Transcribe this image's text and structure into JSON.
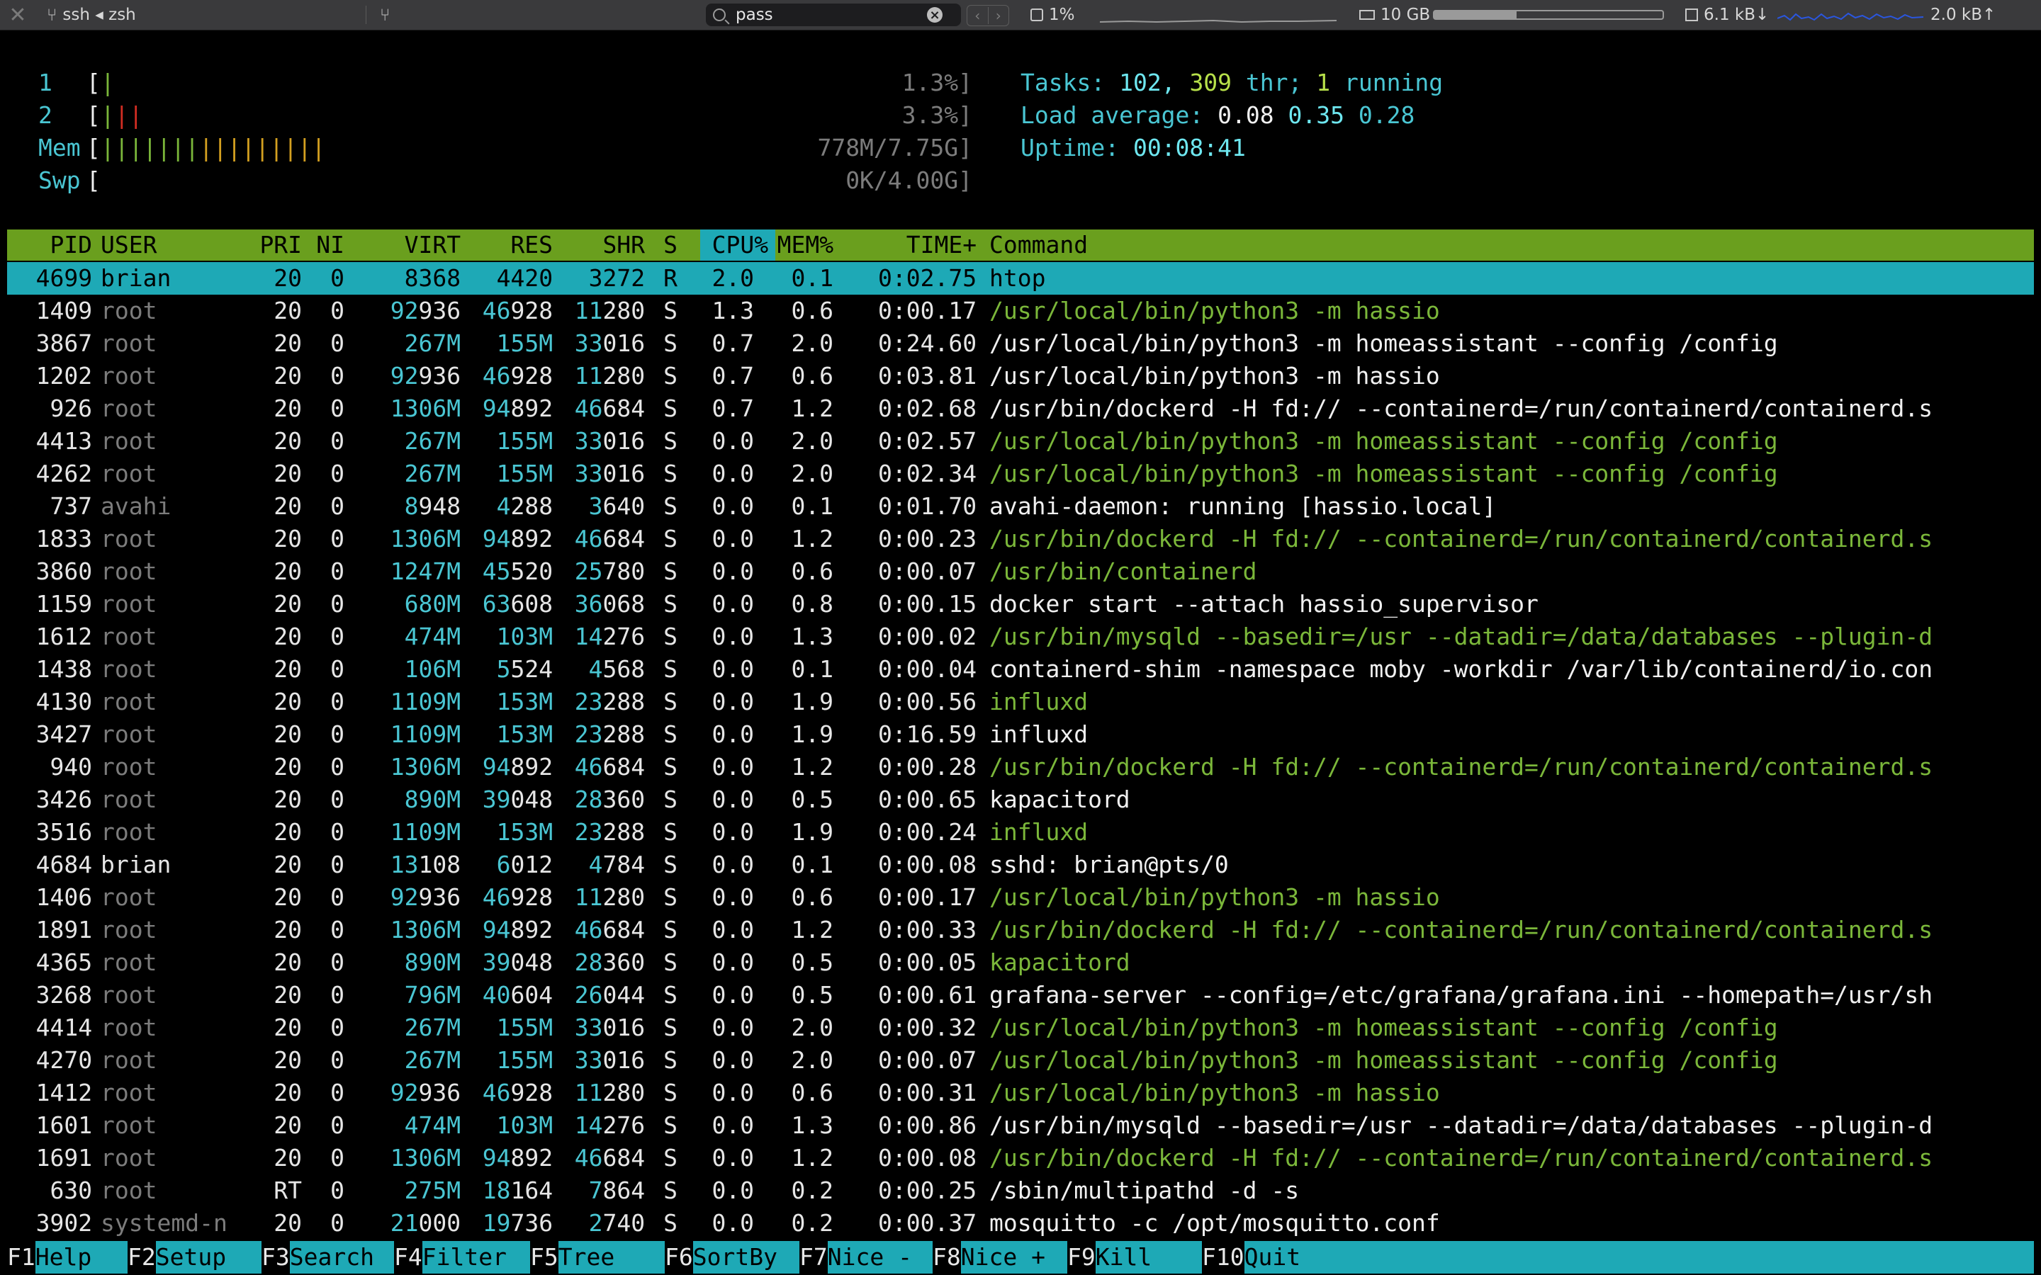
{
  "window": {
    "tab_title": "ssh ◂ zsh",
    "search_value": "pass",
    "cpu_label": "1%",
    "mem_label": "10 GB",
    "mem_fraction": 0.36,
    "net_down": "6.1 kB↓",
    "net_up": "2.0 kB↑",
    "accent": "#1ea9b6"
  },
  "meters": {
    "cpu1": {
      "label": "1",
      "value": "1.3%]",
      "bars": [
        {
          "ch": "|",
          "color": "green"
        }
      ]
    },
    "cpu2": {
      "label": "2",
      "value": "3.3%]",
      "bars": [
        {
          "ch": "|",
          "color": "green"
        },
        {
          "ch": "|",
          "color": "red"
        },
        {
          "ch": "|",
          "color": "red"
        }
      ]
    },
    "mem": {
      "label": "Mem",
      "value": "778M/7.75G]",
      "bars": [
        {
          "ch": "|",
          "color": "green"
        },
        {
          "ch": "|",
          "color": "green"
        },
        {
          "ch": "|",
          "color": "green"
        },
        {
          "ch": "|",
          "color": "green"
        },
        {
          "ch": "|",
          "color": "green"
        },
        {
          "ch": "|",
          "color": "green"
        },
        {
          "ch": "|",
          "color": "green"
        },
        {
          "ch": "|",
          "color": "yellow"
        },
        {
          "ch": "|",
          "color": "yellow"
        },
        {
          "ch": "|",
          "color": "yellow"
        },
        {
          "ch": "|",
          "color": "yellow"
        },
        {
          "ch": "|",
          "color": "yellow"
        },
        {
          "ch": "|",
          "color": "yellow"
        },
        {
          "ch": "|",
          "color": "yellow"
        },
        {
          "ch": "|",
          "color": "yellow"
        },
        {
          "ch": "|",
          "color": "yellow"
        }
      ]
    },
    "swp": {
      "label": "Swp",
      "value": "0K/4.00G]",
      "bars": []
    },
    "bracket": "["
  },
  "summary": {
    "tasks_label": "Tasks: ",
    "tasks": "102",
    "comma": ", ",
    "threads": "309",
    "thr_label": " thr; ",
    "running": "1",
    "running_label": " running",
    "load_label": "Load average: ",
    "load1": "0.08",
    "load5": "0.35",
    "load15": "0.28",
    "uptime_label": "Uptime: ",
    "uptime": "00:08:41"
  },
  "columns": [
    "PID",
    "USER",
    "PRI",
    "NI",
    "VIRT",
    "RES",
    "SHR",
    "S",
    "CPU%",
    "MEM%",
    "TIME+",
    "Command"
  ],
  "processes": [
    {
      "pid": "4699",
      "user": "brian",
      "pri": "20",
      "ni": "0",
      "virt": "8368",
      "res": "4420",
      "shr": "3272",
      "s": "R",
      "cpu": "2.0",
      "mem": "0.1",
      "time": "0:02.75",
      "cmd": "htop",
      "cmdc": "white",
      "sel": true
    },
    {
      "pid": "1409",
      "user": "root",
      "pri": "20",
      "ni": "0",
      "virt": "92936",
      "res": "46928",
      "shr": "11280",
      "s": "S",
      "cpu": "1.3",
      "mem": "0.6",
      "time": "0:00.17",
      "cmd": "/usr/local/bin/python3 -m hassio",
      "cmdc": "green"
    },
    {
      "pid": "3867",
      "user": "root",
      "pri": "20",
      "ni": "0",
      "virt": "267M",
      "res": "155M",
      "shr": "33016",
      "s": "S",
      "cpu": "0.7",
      "mem": "2.0",
      "time": "0:24.60",
      "cmd": "/usr/local/bin/python3 -m homeassistant --config /config",
      "cmdc": "white"
    },
    {
      "pid": "1202",
      "user": "root",
      "pri": "20",
      "ni": "0",
      "virt": "92936",
      "res": "46928",
      "shr": "11280",
      "s": "S",
      "cpu": "0.7",
      "mem": "0.6",
      "time": "0:03.81",
      "cmd": "/usr/local/bin/python3 -m hassio",
      "cmdc": "white"
    },
    {
      "pid": "926",
      "user": "root",
      "pri": "20",
      "ni": "0",
      "virt": "1306M",
      "res": "94892",
      "shr": "46684",
      "s": "S",
      "cpu": "0.7",
      "mem": "1.2",
      "time": "0:02.68",
      "cmd": "/usr/bin/dockerd -H fd:// --containerd=/run/containerd/containerd.s",
      "cmdc": "white"
    },
    {
      "pid": "4413",
      "user": "root",
      "pri": "20",
      "ni": "0",
      "virt": "267M",
      "res": "155M",
      "shr": "33016",
      "s": "S",
      "cpu": "0.0",
      "mem": "2.0",
      "time": "0:02.57",
      "cmd": "/usr/local/bin/python3 -m homeassistant --config /config",
      "cmdc": "green"
    },
    {
      "pid": "4262",
      "user": "root",
      "pri": "20",
      "ni": "0",
      "virt": "267M",
      "res": "155M",
      "shr": "33016",
      "s": "S",
      "cpu": "0.0",
      "mem": "2.0",
      "time": "0:02.34",
      "cmd": "/usr/local/bin/python3 -m homeassistant --config /config",
      "cmdc": "green"
    },
    {
      "pid": "737",
      "user": "avahi",
      "pri": "20",
      "ni": "0",
      "virt": "8948",
      "res": "4288",
      "shr": "3640",
      "s": "S",
      "cpu": "0.0",
      "mem": "0.1",
      "time": "0:01.70",
      "cmd": "avahi-daemon: running [hassio.local]",
      "cmdc": "white"
    },
    {
      "pid": "1833",
      "user": "root",
      "pri": "20",
      "ni": "0",
      "virt": "1306M",
      "res": "94892",
      "shr": "46684",
      "s": "S",
      "cpu": "0.0",
      "mem": "1.2",
      "time": "0:00.23",
      "cmd": "/usr/bin/dockerd -H fd:// --containerd=/run/containerd/containerd.s",
      "cmdc": "green"
    },
    {
      "pid": "3860",
      "user": "root",
      "pri": "20",
      "ni": "0",
      "virt": "1247M",
      "res": "45520",
      "shr": "25780",
      "s": "S",
      "cpu": "0.0",
      "mem": "0.6",
      "time": "0:00.07",
      "cmd": "/usr/bin/containerd",
      "cmdc": "green"
    },
    {
      "pid": "1159",
      "user": "root",
      "pri": "20",
      "ni": "0",
      "virt": "680M",
      "res": "63608",
      "shr": "36068",
      "s": "S",
      "cpu": "0.0",
      "mem": "0.8",
      "time": "0:00.15",
      "cmd": "docker start --attach hassio_supervisor",
      "cmdc": "white"
    },
    {
      "pid": "1612",
      "user": "root",
      "pri": "20",
      "ni": "0",
      "virt": "474M",
      "res": "103M",
      "shr": "14276",
      "s": "S",
      "cpu": "0.0",
      "mem": "1.3",
      "time": "0:00.02",
      "cmd": "/usr/bin/mysqld --basedir=/usr --datadir=/data/databases --plugin-d",
      "cmdc": "green"
    },
    {
      "pid": "1438",
      "user": "root",
      "pri": "20",
      "ni": "0",
      "virt": "106M",
      "res": "5524",
      "shr": "4568",
      "s": "S",
      "cpu": "0.0",
      "mem": "0.1",
      "time": "0:00.04",
      "cmd": "containerd-shim -namespace moby -workdir /var/lib/containerd/io.con",
      "cmdc": "white"
    },
    {
      "pid": "4130",
      "user": "root",
      "pri": "20",
      "ni": "0",
      "virt": "1109M",
      "res": "153M",
      "shr": "23288",
      "s": "S",
      "cpu": "0.0",
      "mem": "1.9",
      "time": "0:00.56",
      "cmd": "influxd",
      "cmdc": "green"
    },
    {
      "pid": "3427",
      "user": "root",
      "pri": "20",
      "ni": "0",
      "virt": "1109M",
      "res": "153M",
      "shr": "23288",
      "s": "S",
      "cpu": "0.0",
      "mem": "1.9",
      "time": "0:16.59",
      "cmd": "influxd",
      "cmdc": "white"
    },
    {
      "pid": "940",
      "user": "root",
      "pri": "20",
      "ni": "0",
      "virt": "1306M",
      "res": "94892",
      "shr": "46684",
      "s": "S",
      "cpu": "0.0",
      "mem": "1.2",
      "time": "0:00.28",
      "cmd": "/usr/bin/dockerd -H fd:// --containerd=/run/containerd/containerd.s",
      "cmdc": "green"
    },
    {
      "pid": "3426",
      "user": "root",
      "pri": "20",
      "ni": "0",
      "virt": "890M",
      "res": "39048",
      "shr": "28360",
      "s": "S",
      "cpu": "0.0",
      "mem": "0.5",
      "time": "0:00.65",
      "cmd": "kapacitord",
      "cmdc": "white"
    },
    {
      "pid": "3516",
      "user": "root",
      "pri": "20",
      "ni": "0",
      "virt": "1109M",
      "res": "153M",
      "shr": "23288",
      "s": "S",
      "cpu": "0.0",
      "mem": "1.9",
      "time": "0:00.24",
      "cmd": "influxd",
      "cmdc": "green"
    },
    {
      "pid": "4684",
      "user": "brian",
      "pri": "20",
      "ni": "0",
      "virt": "13108",
      "res": "6012",
      "shr": "4784",
      "s": "S",
      "cpu": "0.0",
      "mem": "0.1",
      "time": "0:00.08",
      "cmd": "sshd: brian@pts/0",
      "cmdc": "white"
    },
    {
      "pid": "1406",
      "user": "root",
      "pri": "20",
      "ni": "0",
      "virt": "92936",
      "res": "46928",
      "shr": "11280",
      "s": "S",
      "cpu": "0.0",
      "mem": "0.6",
      "time": "0:00.17",
      "cmd": "/usr/local/bin/python3 -m hassio",
      "cmdc": "green"
    },
    {
      "pid": "1891",
      "user": "root",
      "pri": "20",
      "ni": "0",
      "virt": "1306M",
      "res": "94892",
      "shr": "46684",
      "s": "S",
      "cpu": "0.0",
      "mem": "1.2",
      "time": "0:00.33",
      "cmd": "/usr/bin/dockerd -H fd:// --containerd=/run/containerd/containerd.s",
      "cmdc": "green"
    },
    {
      "pid": "4365",
      "user": "root",
      "pri": "20",
      "ni": "0",
      "virt": "890M",
      "res": "39048",
      "shr": "28360",
      "s": "S",
      "cpu": "0.0",
      "mem": "0.5",
      "time": "0:00.05",
      "cmd": "kapacitord",
      "cmdc": "green"
    },
    {
      "pid": "3268",
      "user": "root",
      "pri": "20",
      "ni": "0",
      "virt": "796M",
      "res": "40604",
      "shr": "26044",
      "s": "S",
      "cpu": "0.0",
      "mem": "0.5",
      "time": "0:00.61",
      "cmd": "grafana-server --config=/etc/grafana/grafana.ini --homepath=/usr/sh",
      "cmdc": "white"
    },
    {
      "pid": "4414",
      "user": "root",
      "pri": "20",
      "ni": "0",
      "virt": "267M",
      "res": "155M",
      "shr": "33016",
      "s": "S",
      "cpu": "0.0",
      "mem": "2.0",
      "time": "0:00.32",
      "cmd": "/usr/local/bin/python3 -m homeassistant --config /config",
      "cmdc": "green"
    },
    {
      "pid": "4270",
      "user": "root",
      "pri": "20",
      "ni": "0",
      "virt": "267M",
      "res": "155M",
      "shr": "33016",
      "s": "S",
      "cpu": "0.0",
      "mem": "2.0",
      "time": "0:00.07",
      "cmd": "/usr/local/bin/python3 -m homeassistant --config /config",
      "cmdc": "green"
    },
    {
      "pid": "1412",
      "user": "root",
      "pri": "20",
      "ni": "0",
      "virt": "92936",
      "res": "46928",
      "shr": "11280",
      "s": "S",
      "cpu": "0.0",
      "mem": "0.6",
      "time": "0:00.31",
      "cmd": "/usr/local/bin/python3 -m hassio",
      "cmdc": "green"
    },
    {
      "pid": "1601",
      "user": "root",
      "pri": "20",
      "ni": "0",
      "virt": "474M",
      "res": "103M",
      "shr": "14276",
      "s": "S",
      "cpu": "0.0",
      "mem": "1.3",
      "time": "0:00.86",
      "cmd": "/usr/bin/mysqld --basedir=/usr --datadir=/data/databases --plugin-d",
      "cmdc": "white"
    },
    {
      "pid": "1691",
      "user": "root",
      "pri": "20",
      "ni": "0",
      "virt": "1306M",
      "res": "94892",
      "shr": "46684",
      "s": "S",
      "cpu": "0.0",
      "mem": "1.2",
      "time": "0:00.08",
      "cmd": "/usr/bin/dockerd -H fd:// --containerd=/run/containerd/containerd.s",
      "cmdc": "green"
    },
    {
      "pid": "630",
      "user": "root",
      "pri": "RT",
      "ni": "0",
      "virt": "275M",
      "res": "18164",
      "shr": "7864",
      "s": "S",
      "cpu": "0.0",
      "mem": "0.2",
      "time": "0:00.25",
      "cmd": "/sbin/multipathd -d -s",
      "cmdc": "white"
    },
    {
      "pid": "3902",
      "user": "systemd-n",
      "pri": "20",
      "ni": "0",
      "virt": "21000",
      "res": "19736",
      "shr": "2740",
      "s": "S",
      "cpu": "0.0",
      "mem": "0.2",
      "time": "0:00.37",
      "cmd": "mosquitto -c /opt/mosquitto.conf",
      "cmdc": "white"
    }
  ],
  "function_keys": [
    {
      "key": "F1",
      "label": "Help  "
    },
    {
      "key": "F2",
      "label": "Setup "
    },
    {
      "key": "F3",
      "label": "Search"
    },
    {
      "key": "F4",
      "label": "Filter"
    },
    {
      "key": "F5",
      "label": "Tree  "
    },
    {
      "key": "F6",
      "label": "SortBy"
    },
    {
      "key": "F7",
      "label": "Nice -"
    },
    {
      "key": "F8",
      "label": "Nice +"
    },
    {
      "key": "F9",
      "label": "Kill  "
    },
    {
      "key": "F10",
      "label": "Quit"
    }
  ]
}
